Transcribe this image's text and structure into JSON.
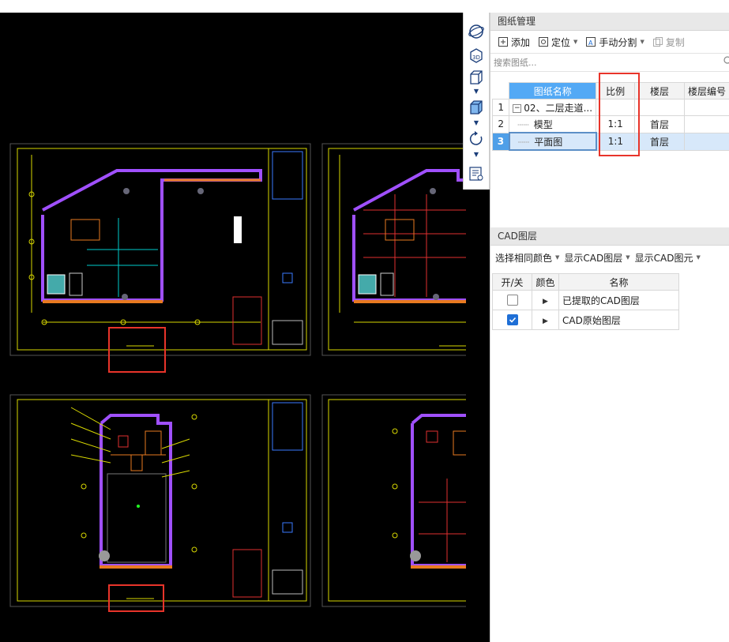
{
  "drawing_manager": {
    "title": "图纸管理",
    "toolbar": {
      "add": "添加",
      "locate": "定位",
      "manual_split": "手动分割",
      "copy": "复制"
    },
    "search_placeholder": "搜索图纸...",
    "columns": [
      "图纸名称",
      "比例",
      "楼层",
      "楼层编号"
    ],
    "rows": [
      {
        "index": "1",
        "name": "02、二层走道...",
        "scale": "",
        "floor": "",
        "floor_no": ""
      },
      {
        "index": "2",
        "name": "模型",
        "scale": "1:1",
        "floor": "首层",
        "floor_no": ""
      },
      {
        "index": "3",
        "name": "平面图",
        "scale": "1:1",
        "floor": "首层",
        "floor_no": ""
      }
    ]
  },
  "cad_layers": {
    "title": "CAD图层",
    "toolbar": {
      "select_same_color": "选择相同颜色",
      "show_cad_layer": "显示CAD图层",
      "show_cad_element": "显示CAD图元"
    },
    "columns": [
      "开/关",
      "颜色",
      "名称"
    ],
    "rows": [
      {
        "on": false,
        "name": "已提取的CAD图层"
      },
      {
        "on": true,
        "name": "CAD原始图层"
      }
    ]
  },
  "side_tools": [
    "orbit-icon",
    "view-3d-icon",
    "box-view-icon",
    "solid-view-icon",
    "rotate-icon",
    "layer-list-icon"
  ],
  "colors": {
    "accent_header": "#53a9f5",
    "selection": "#d7e8fa",
    "highlight_box": "#e8342a",
    "cad_bg": "#000000"
  }
}
